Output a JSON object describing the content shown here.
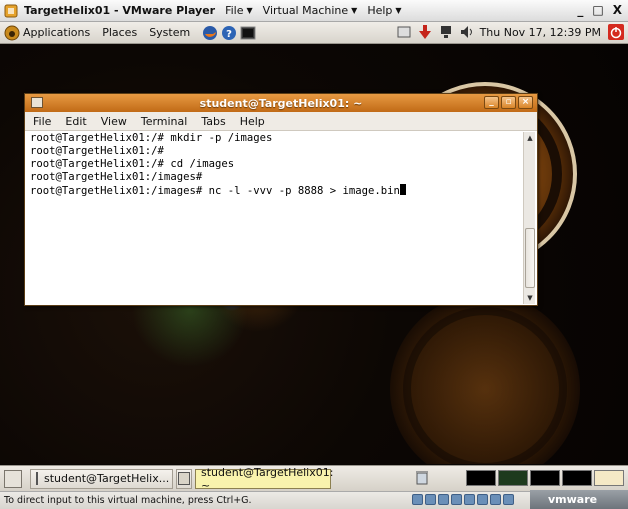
{
  "vmware": {
    "title": "TargetHelix01 - VMware Player",
    "menus": [
      "File",
      "Virtual Machine",
      "Help"
    ],
    "controls": [
      "_",
      "□",
      "X"
    ]
  },
  "top_panel": {
    "menus": [
      "Applications",
      "Places",
      "System"
    ],
    "clock": "Thu Nov 17, 12:39 PM"
  },
  "terminal": {
    "title": "student@TargetHelix01: ~",
    "menu": [
      "File",
      "Edit",
      "View",
      "Terminal",
      "Tabs",
      "Help"
    ],
    "lines": [
      "root@TargetHelix01:/# mkdir -p /images",
      "root@TargetHelix01:/#",
      "root@TargetHelix01:/# cd /images",
      "root@TargetHelix01:/images#",
      "root@TargetHelix01:/images# nc -l -vvv -p 8888 > image.bin"
    ]
  },
  "bottom_panel": {
    "tasks": [
      "student@TargetHelix...",
      "student@TargetHelix01: ~"
    ]
  },
  "status_bar": {
    "text": "To direct input to this virtual machine, press Ctrl+G.",
    "brand": "vmware"
  },
  "colors": {
    "title_orange": "#d27a22",
    "active_task": "#f9f3ad"
  }
}
